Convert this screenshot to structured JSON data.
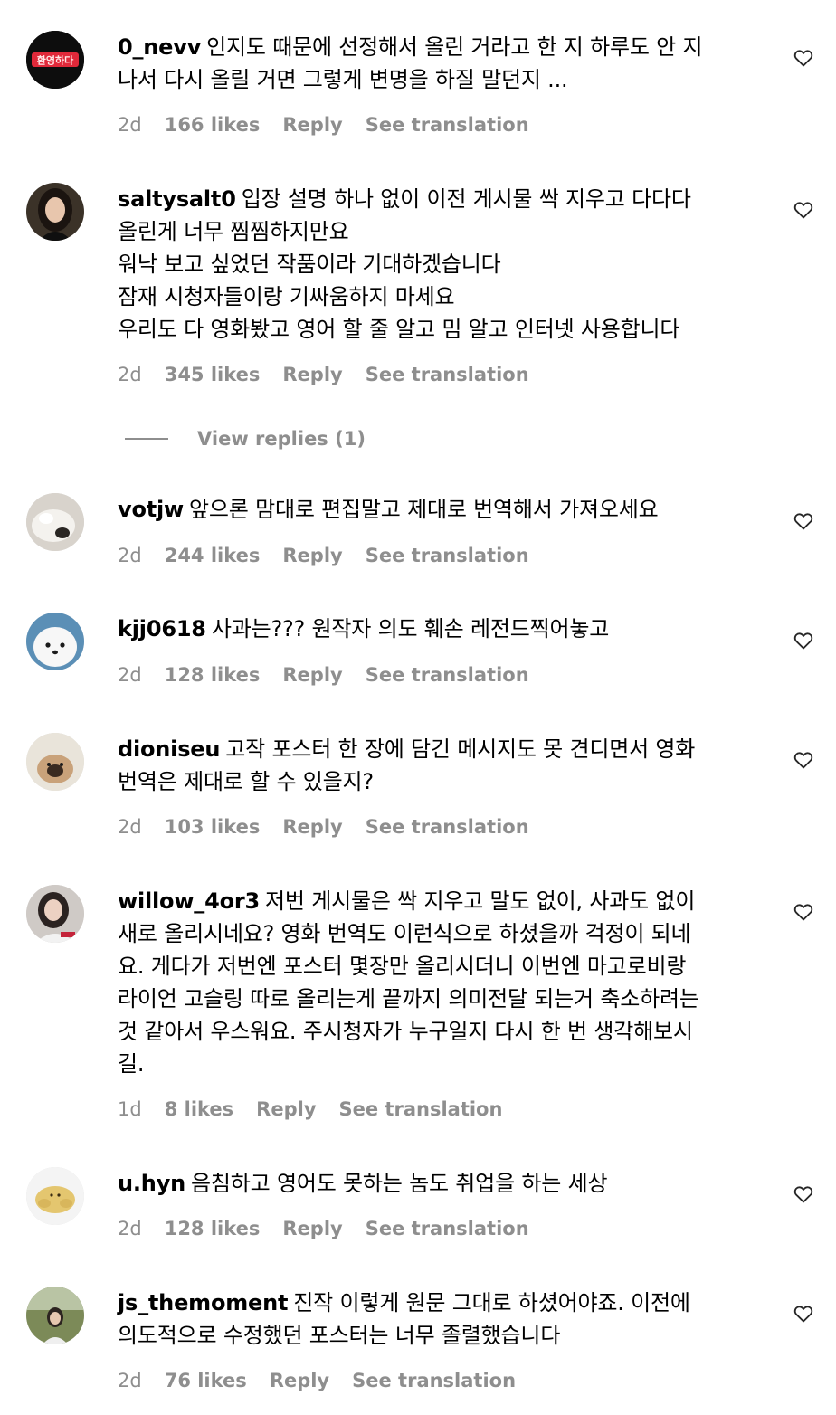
{
  "labels": {
    "reply": "Reply",
    "see_translation": "See translation",
    "view_replies": "View replies (1)"
  },
  "comments": [
    {
      "username": "0_nevv",
      "text": "인지도 때문에 선정해서 올린 거라고 한 지 하루도 안 지\n나서 다시 올릴 거면 그렇게 변명을 하질 말던지 ...",
      "time": "2d",
      "likes": "166 likes",
      "avatar_text": "환영하다"
    },
    {
      "username": "saltysalt0",
      "text": "입장 설명 하나 없이 이전 게시물 싹 지우고 다다다\n올린게 너무 찜찜하지만요\n워낙 보고 싶었던 작품이라 기대하겠습니다\n잠재 시청자들이랑 기싸움하지 마세요\n우리도 다 영화봤고 영어 할 줄 알고 밈 알고 인터넷 사용합니다",
      "time": "2d",
      "likes": "345 likes"
    },
    {
      "username": "votjw",
      "text": "앞으론 맘대로 편집말고 제대로 번역해서 가져오세요",
      "time": "2d",
      "likes": "244 likes"
    },
    {
      "username": "kjj0618",
      "text": "사과는??? 원작자 의도 훼손 레전드찍어놓고",
      "time": "2d",
      "likes": "128 likes"
    },
    {
      "username": "dioniseu",
      "text": "고작 포스터 한 장에 담긴 메시지도 못 견디면서 영화\n번역은 제대로 할 수 있을지?",
      "time": "2d",
      "likes": "103 likes"
    },
    {
      "username": "willow_4or3",
      "text": "저번 게시물은 싹 지우고 말도 없이, 사과도 없이\n새로 올리시네요? 영화 번역도 이런식으로 하셨을까 걱정이 되네\n요. 게다가 저번엔 포스터 몇장만 올리시더니 이번엔 마고로비랑\n라이언 고슬링 따로 올리는게 끝까지 의미전달 되는거 축소하려는\n것 같아서 우스워요. 주시청자가 누구일지 다시 한 번 생각해보시\n길.",
      "time": "1d",
      "likes": "8 likes"
    },
    {
      "username": "u.hyn",
      "text": "음침하고 영어도 못하는 놈도 취업을 하는 세상",
      "time": "2d",
      "likes": "128 likes"
    },
    {
      "username": "js_themoment",
      "text": "진작 이렇게 원문 그대로 하셨어야죠. 이전에\n의도적으로 수정했던 포스터는 너무 졸렬했습니다",
      "time": "2d",
      "likes": "76 likes"
    }
  ],
  "icons": {
    "like": "heart-outline-icon"
  }
}
